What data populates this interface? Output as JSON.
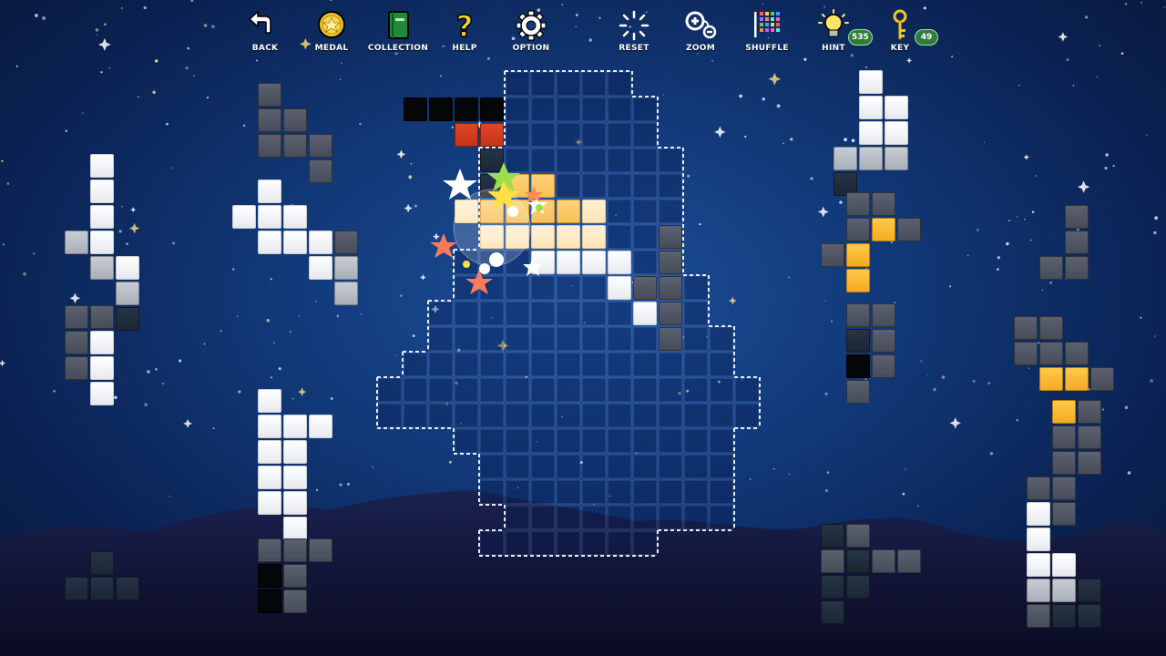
{
  "toolbar": {
    "left": [
      {
        "key": "back",
        "label": "BACK",
        "icon": "back-arrow-icon"
      },
      {
        "key": "medal",
        "label": "MEDAL",
        "icon": "medal-icon"
      },
      {
        "key": "collection",
        "label": "COLLECTION",
        "icon": "book-icon"
      },
      {
        "key": "help",
        "label": "HELP",
        "icon": "question-icon"
      },
      {
        "key": "option",
        "label": "OPTION",
        "icon": "gear-icon"
      }
    ],
    "right": [
      {
        "key": "reset",
        "label": "RESET",
        "icon": "reset-icon"
      },
      {
        "key": "zoom",
        "label": "ZOOM",
        "icon": "zoom-icon"
      },
      {
        "key": "shuffle",
        "label": "SHUFFLE",
        "icon": "shuffle-icon"
      },
      {
        "key": "hint",
        "label": "HINT",
        "icon": "lightbulb-icon",
        "count": "535"
      },
      {
        "key": "key",
        "label": "KEY",
        "icon": "key-icon",
        "count": "49"
      }
    ]
  },
  "colors": {
    "white": "#ffffff",
    "gray": "#4b505c",
    "dark": "#1f2a3b",
    "yellow": "#f6b22d",
    "light": "#b7bcc6",
    "black": "#050608",
    "red": "#cf3a1b",
    "orange": "#f8c15a",
    "peach": "#ffe6bb",
    "outline": "#7fe6e0"
  }
}
